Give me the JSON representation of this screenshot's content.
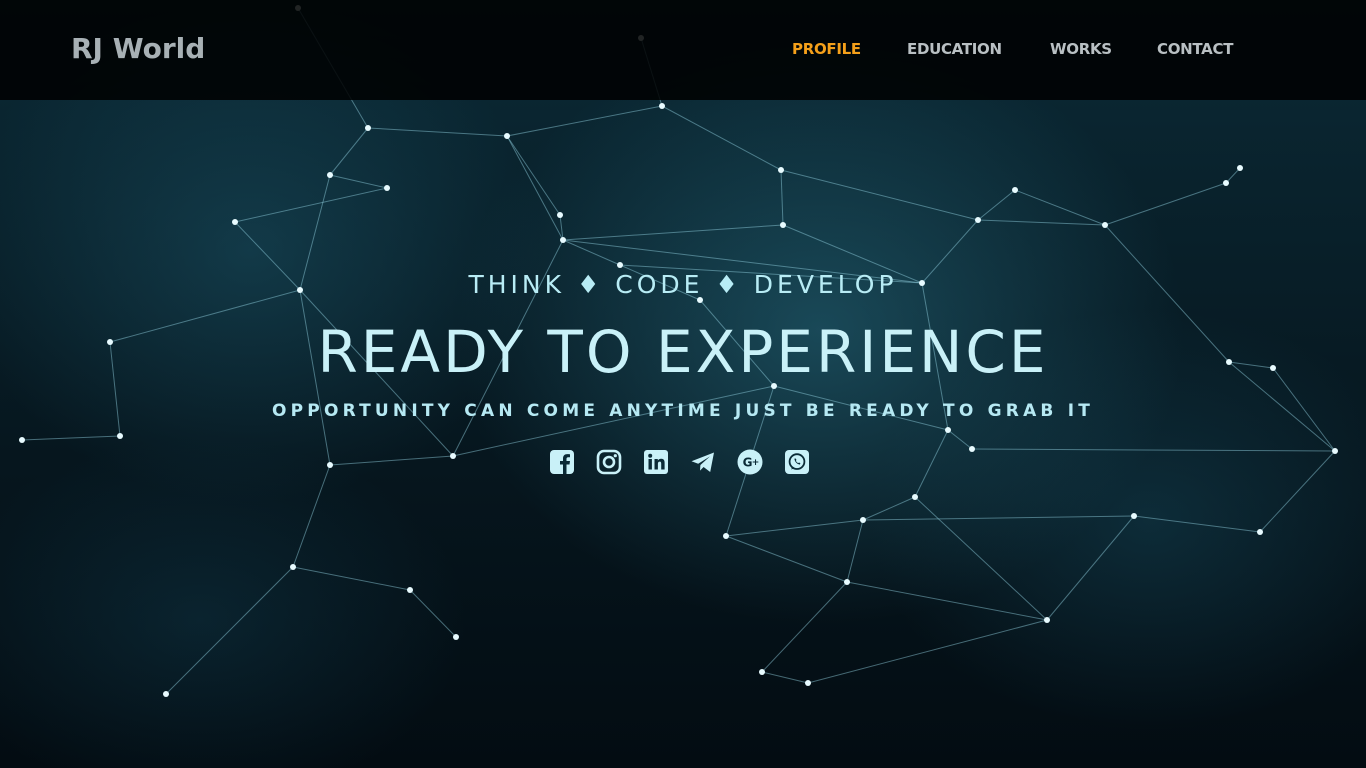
{
  "navbar": {
    "brand": "RJ World",
    "links": [
      {
        "label": "PROFILE",
        "active": true
      },
      {
        "label": "EDUCATION",
        "active": false
      },
      {
        "label": "WORKS",
        "active": false
      },
      {
        "label": "CONTACT",
        "active": false
      }
    ]
  },
  "hero": {
    "tagline": "THINK ♦ CODE ♦ DEVELOP",
    "headline": "READY TO EXPERIENCE",
    "subline": "OPPORTUNITY CAN COME ANYTIME JUST BE READY TO GRAB IT"
  },
  "social": [
    {
      "icon": "facebook-icon"
    },
    {
      "icon": "instagram-icon"
    },
    {
      "icon": "linkedin-icon"
    },
    {
      "icon": "telegram-icon"
    },
    {
      "icon": "google-plus-icon"
    },
    {
      "icon": "whatsapp-icon"
    }
  ],
  "colors": {
    "active_nav": "#f5a01a",
    "nav_text": "#b9c0c3",
    "hero_text": "#c9f1f8",
    "navbar_bg": "#000000"
  }
}
